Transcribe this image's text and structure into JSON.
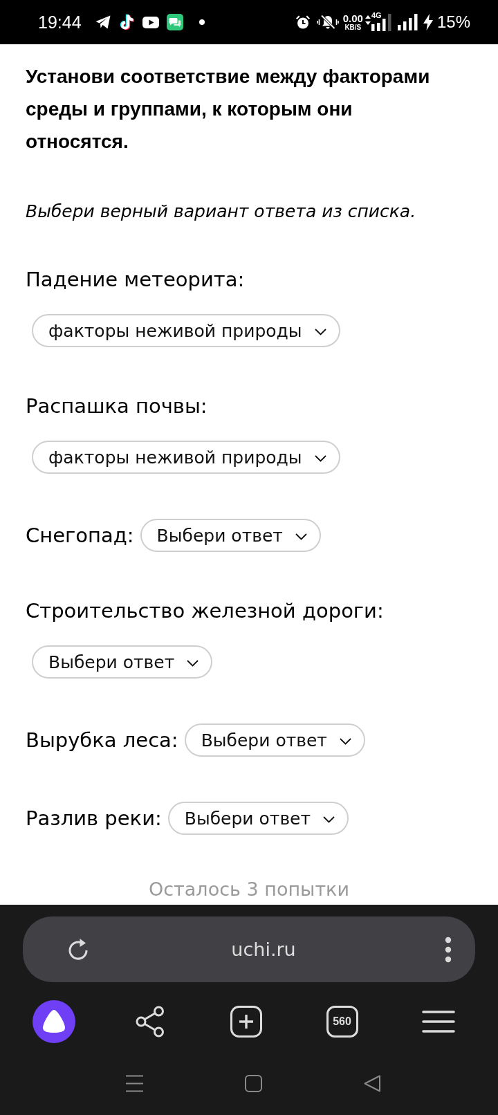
{
  "status_bar": {
    "time": "19:44",
    "speed_value": "0.00",
    "speed_unit": "KB/S",
    "network": "4G",
    "battery": "15%"
  },
  "task": {
    "prompt": "Установи соответствие между факторами среды и группами, к которым они относятся.",
    "instruction": "Выбери верный вариант ответа из списка."
  },
  "matches": [
    {
      "label": "Падение метеорита:",
      "answer": "факторы неживой природы"
    },
    {
      "label": "Распашка почвы:",
      "answer": "факторы неживой природы"
    },
    {
      "label": "Снегопад:",
      "answer": "Выбери ответ"
    },
    {
      "label": "Строительство железной дороги:",
      "answer": "Выбери ответ"
    },
    {
      "label": "Вырубка леса:",
      "answer": "Выбери ответ"
    },
    {
      "label": "Разлив реки:",
      "answer": "Выбери ответ"
    }
  ],
  "attempts": "Осталось 3 попытки",
  "browser": {
    "url": "uchi.ru",
    "tab_count": "560"
  }
}
